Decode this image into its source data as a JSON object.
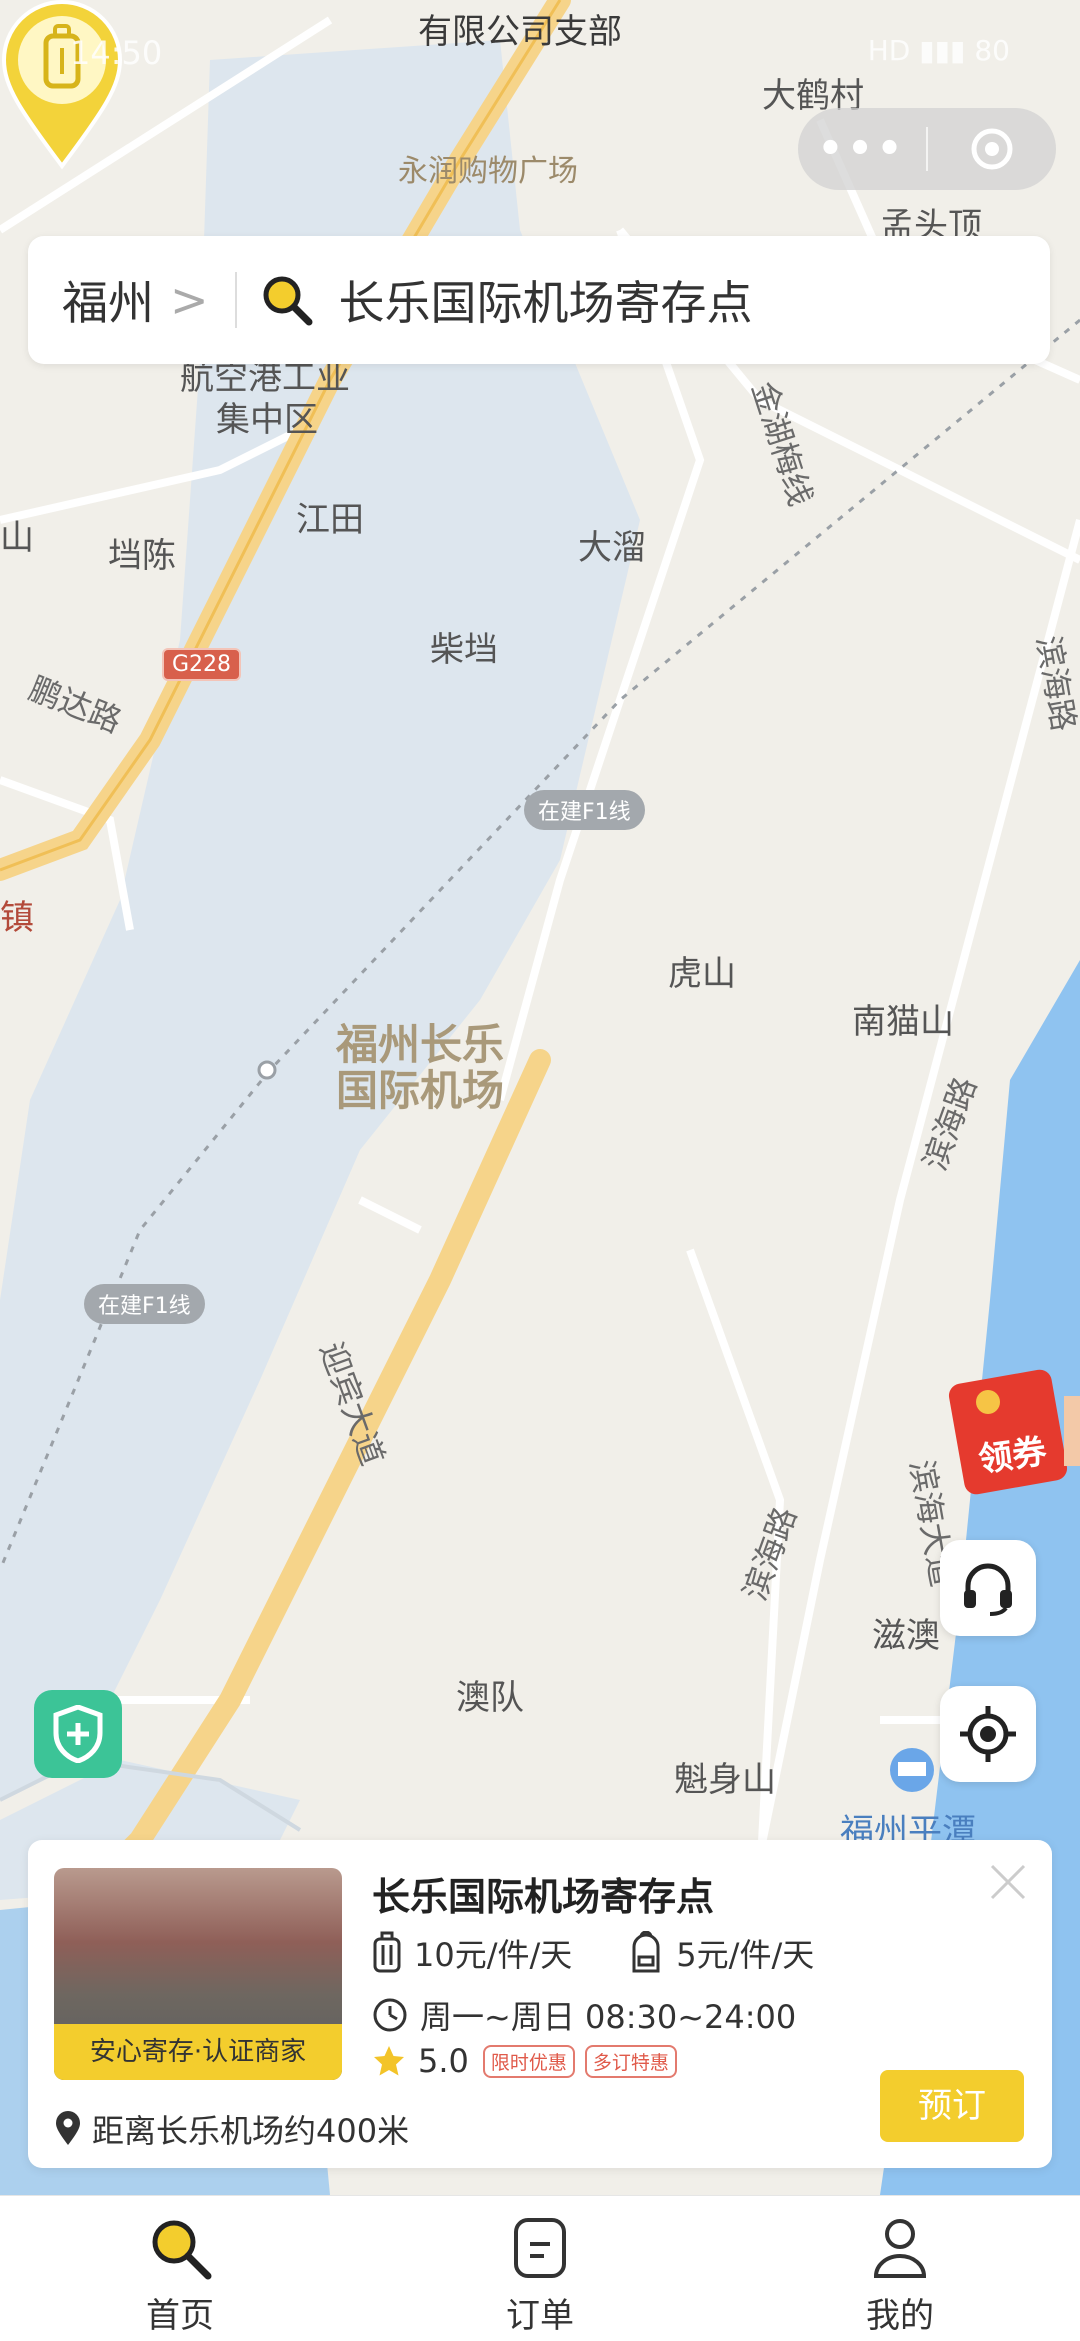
{
  "status_bar": {
    "time": "14:50",
    "right_text": "HD ▮▮▮ 80"
  },
  "capsule": {
    "more_label": "•••"
  },
  "search": {
    "city": "福州",
    "chevron": ">",
    "placeholder": "长乐国际机场寄存点"
  },
  "map": {
    "labels": {
      "company": "有限公司支部",
      "mall": "永润购物广场",
      "dahecun": "大鹤村",
      "mengtouding": "孟头顶",
      "airport_zone": "航空港工业",
      "airport_zone2": "集中区",
      "jiangtian": "江田",
      "dangchen": "垱陈",
      "daliu": "大溜",
      "chaidang": "柴垱",
      "pengda_road": "鹏达路",
      "g228": "G228",
      "f1_line_1": "在建F1线",
      "f1_line_2": "在建F1线",
      "jinhu_line": "金湖梅线",
      "binhai_road_1": "滨海路",
      "binhai_road_2": "滨海路",
      "binhai_road_3": "滨海路",
      "binhai_avenue": "滨海大道",
      "yingbin_avenue": "迎宾大道",
      "hushan": "虎山",
      "nanmaoshan": "南猫山",
      "airport_line1": "福州长乐",
      "airport_line2": "国际机场",
      "aodui": "澳队",
      "kuishenshan": "魁身山",
      "ziao": "滋澳",
      "fuzhou_pingtan": "福州平潭",
      "zhen": "镇",
      "shan": "山"
    }
  },
  "coupon": {
    "label": "领券"
  },
  "store": {
    "name": "长乐国际机场寄存点",
    "badge": "安心寄存·认证商家",
    "price_luggage": "10元/件/天",
    "price_bag": "5元/件/天",
    "hours": "周一~周日 08:30~24:00",
    "rating": "5.0",
    "tag1": "限时优惠",
    "tag2": "多订特惠",
    "distance": "距离长乐机场约400米",
    "book_label": "预订"
  },
  "tabs": [
    {
      "label": "首页"
    },
    {
      "label": "订单"
    },
    {
      "label": "我的"
    }
  ],
  "colors": {
    "accent": "#f3cd2d",
    "water": "#dde6ee",
    "road": "#f6d48a",
    "shield": "#3cc497"
  }
}
